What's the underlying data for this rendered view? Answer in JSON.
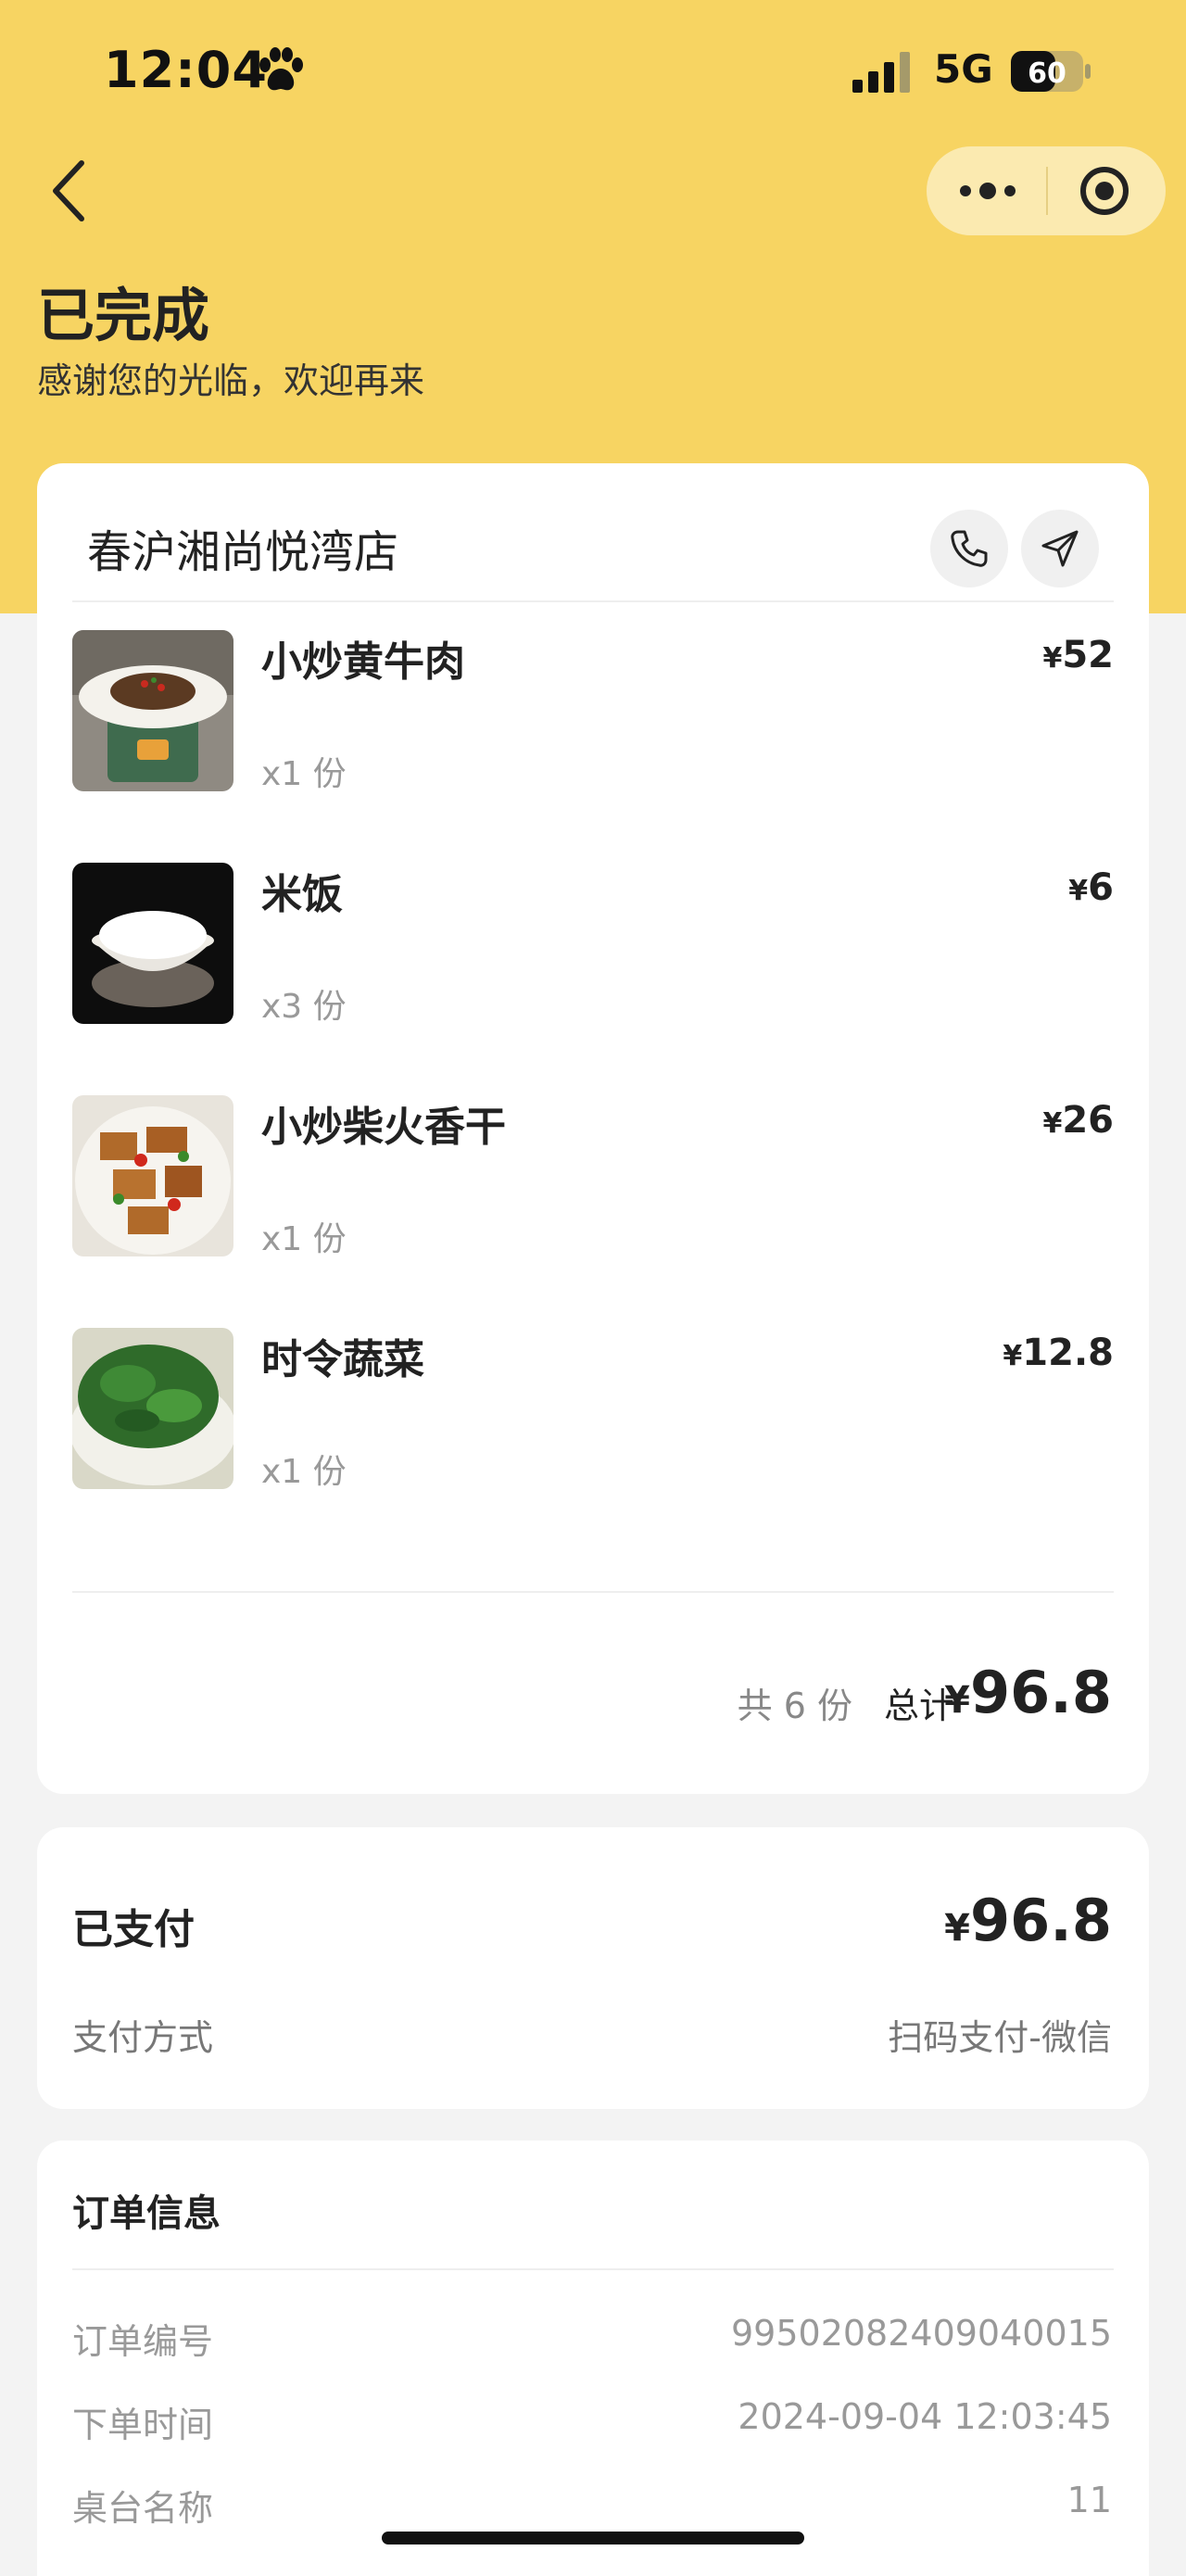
{
  "status_bar": {
    "time": "12:04",
    "network": "5G",
    "battery": "60"
  },
  "header": {
    "status_title": "已完成",
    "status_subtitle": "感谢您的光临，欢迎再来"
  },
  "store": {
    "name": "春沪湘尚悦湾店"
  },
  "items": [
    {
      "name": "小炒黄牛肉",
      "qty": "x1 份",
      "currency": "¥",
      "price": "52"
    },
    {
      "name": "米饭",
      "qty": "x3 份",
      "currency": "¥",
      "price": "6"
    },
    {
      "name": "小炒柴火香干",
      "qty": "x1 份",
      "currency": "¥",
      "price": "26"
    },
    {
      "name": "时令蔬菜",
      "qty": "x1 份",
      "currency": "¥",
      "price": "12.8"
    }
  ],
  "summary": {
    "count_text": "共 6 份",
    "total_label": "总计",
    "currency": "¥",
    "total": "96.8"
  },
  "payment": {
    "paid_label": "已支付",
    "currency": "¥",
    "paid_amount": "96.8",
    "method_label": "支付方式",
    "method_value": "扫码支付-微信"
  },
  "order_info": {
    "title": "订单信息",
    "rows": [
      {
        "label": "订单编号",
        "value": "99502082409040015"
      },
      {
        "label": "下单时间",
        "value": "2024-09-04 12:03:45"
      },
      {
        "label": "桌台名称",
        "value": "11"
      }
    ]
  },
  "colors": {
    "header_bg": "#f7d462",
    "capsule_bg": "#fbeab0",
    "page_bg": "#f3f3f3"
  }
}
